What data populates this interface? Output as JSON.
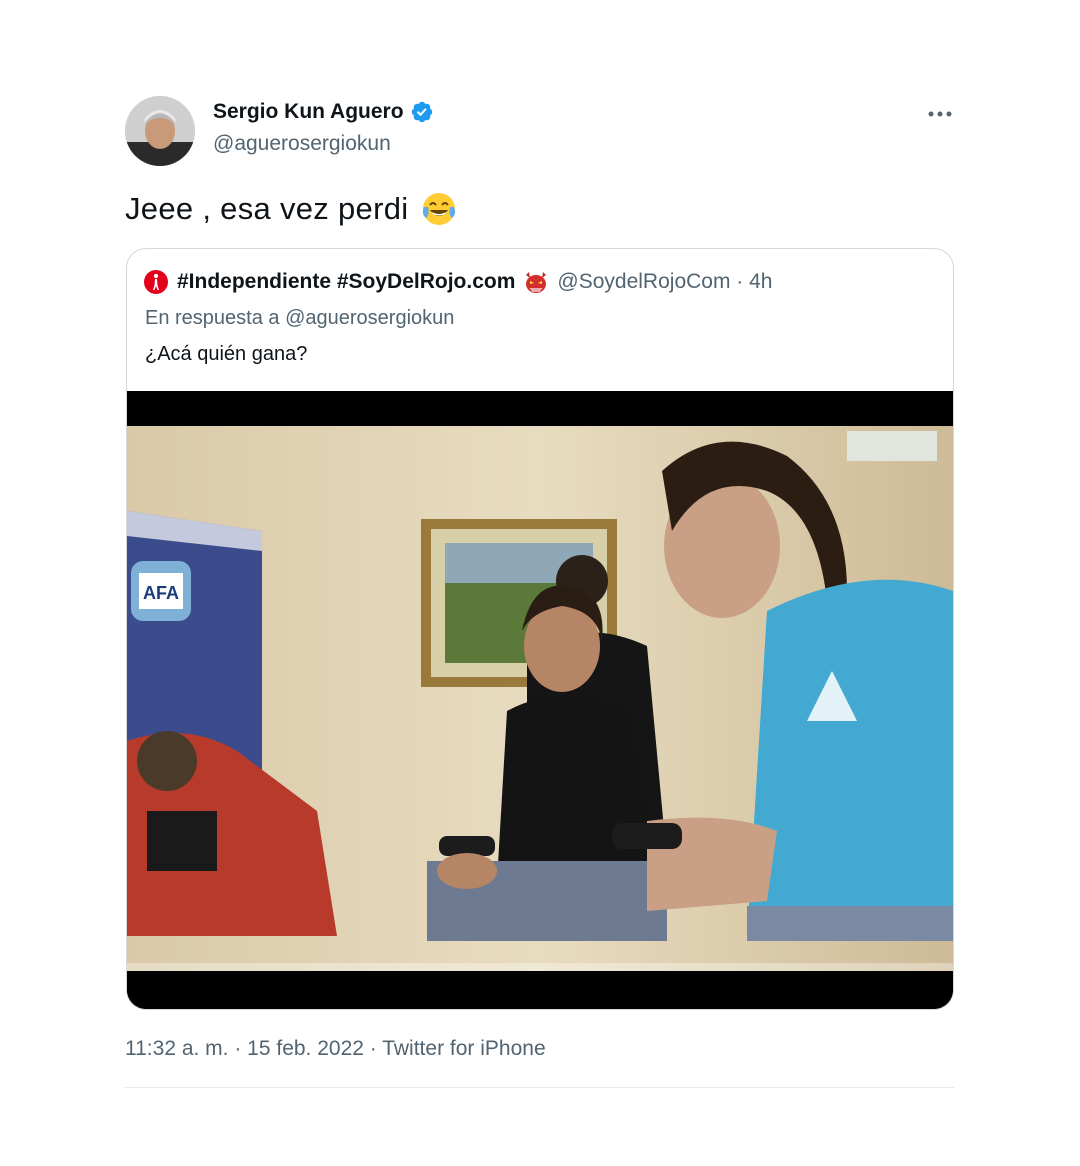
{
  "tweet": {
    "author": {
      "name": "Sergio Kun Aguero",
      "handle": "@aguerosergiokun",
      "verified": true,
      "avatar_icon": "profile-photo"
    },
    "text": "Jeee , esa vez perdi",
    "emoji_icon": "face-with-tears-of-joy-emoji",
    "more_icon": "more-options-icon",
    "quoted": {
      "name": "#Independiente #SoyDelRojo.com",
      "name_emoji_icon": "red-devil-mask-emoji",
      "logo_icon": "independiente-club-logo",
      "handle_time": "@SoydelRojoCom · 4h",
      "reply_prefix": "En respuesta a @aguerosergiokun",
      "text": "¿Acá quién gana?",
      "media_description_icon": "photo-two-men-playing-videogame"
    },
    "footer": "11:32 a. m. · 15 feb. 2022 · Twitter for iPhone"
  },
  "colors": {
    "verified_blue": "#1d9bf0",
    "secondary_text": "#536471",
    "border": "#cfd9de",
    "independiente_red": "#e2001a"
  }
}
